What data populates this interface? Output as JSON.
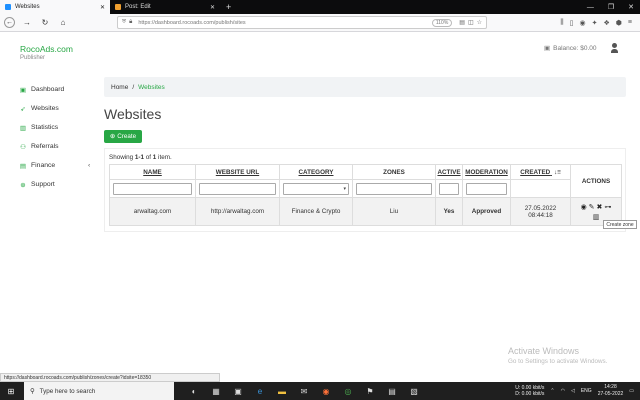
{
  "browser": {
    "tabs": [
      {
        "label": "Websites",
        "active": true
      },
      {
        "label": "Post: Edit",
        "active": false
      }
    ],
    "new_tab": "+",
    "url": "https://dashboard.rocoads.com/publish/sites",
    "zoom": "110%",
    "status_url": "https://dashboard.rocoads.com/publish/zones/create?idsite=18350"
  },
  "app": {
    "brand_name": "RocoAds.com",
    "brand_sub": "Publisher",
    "balance": "Balance: $0.00"
  },
  "sidebar": {
    "items": [
      {
        "label": "Dashboard",
        "icon": "dashboard-icon",
        "glyph": "▣"
      },
      {
        "label": "Websites",
        "icon": "rocket-icon",
        "glyph": "➶"
      },
      {
        "label": "Statistics",
        "icon": "chart-icon",
        "glyph": "▥"
      },
      {
        "label": "Referrals",
        "icon": "users-icon",
        "glyph": "⚇"
      },
      {
        "label": "Finance",
        "icon": "money-icon",
        "glyph": "▤"
      },
      {
        "label": "Support",
        "icon": "lifering-icon",
        "glyph": "⊕"
      }
    ],
    "finance_arrow": "‹"
  },
  "breadcrumb": {
    "home": "Home",
    "separator": "/",
    "current": "Websites"
  },
  "page": {
    "title": "Websites",
    "create_label": "Create",
    "create_icon": "⊕"
  },
  "summary": {
    "prefix": "Showing ",
    "range": "1-1",
    "middle": " of ",
    "total": "1",
    "suffix": " item."
  },
  "table": {
    "headers": [
      "NAME",
      "WEBSITE URL",
      "CATEGORY",
      "ZONES",
      "ACTIVE",
      "MODERATION",
      "CREATED",
      "ACTIONS"
    ],
    "sort_icon": "↓≡",
    "rows": [
      {
        "name": "arwaltag.com",
        "url": "http://arwaltag.com",
        "category": "Finance & Crypto",
        "zones": "Liu",
        "active": "Yes",
        "moderation": "Approved",
        "created_date": "27.05.2022",
        "created_time": "08:44:18"
      }
    ],
    "action_icons": [
      "eye-icon",
      "pencil-icon",
      "times-circle-icon",
      "sitemap-icon",
      "bar-chart-icon"
    ]
  },
  "tooltip": "Create zone",
  "watermark": {
    "line1": "Activate Windows",
    "line2": "Go to Settings to activate Windows."
  },
  "taskbar": {
    "search_placeholder": "Type here to search",
    "net_up": "0.00 kbit/s",
    "net_down": "0.00 kbit/s",
    "net_up_label": "U:",
    "net_down_label": "D:",
    "lang": "ENG",
    "time": "14:28",
    "date": "27-05-2022"
  },
  "colors": {
    "accent": "#28a745",
    "title": "#444444"
  }
}
